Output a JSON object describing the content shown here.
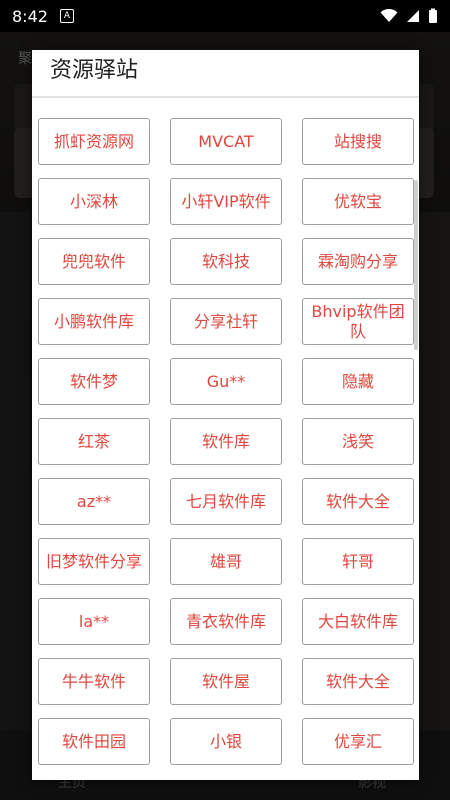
{
  "status_bar": {
    "time": "8:42"
  },
  "background": {
    "title": "聚",
    "nav_home": "主页",
    "nav_video": "影视"
  },
  "dialog": {
    "title": "资源驿站",
    "items": [
      "抓虾资源网",
      "MVCAT",
      "站搜搜",
      "小深林",
      "小轩VIP软件",
      "优软宝",
      "兜兜软件",
      "软科技",
      "霖淘购分享",
      "小鹏软件库",
      "分享社轩",
      "Bhvip软件团队",
      "软件梦",
      "Gu**",
      "隐藏",
      "红茶",
      "软件库",
      "浅笑",
      "az**",
      "七月软件库",
      "软件大全",
      "旧梦软件分享",
      "雄哥",
      "轩哥",
      "la**",
      "青衣软件库",
      "大白软件库",
      "牛牛软件",
      "软件屋",
      "软件大全",
      "软件田园",
      "小银",
      "优享汇"
    ]
  },
  "colors": {
    "item_text": "#e0473e",
    "border": "#9e9e9e"
  }
}
